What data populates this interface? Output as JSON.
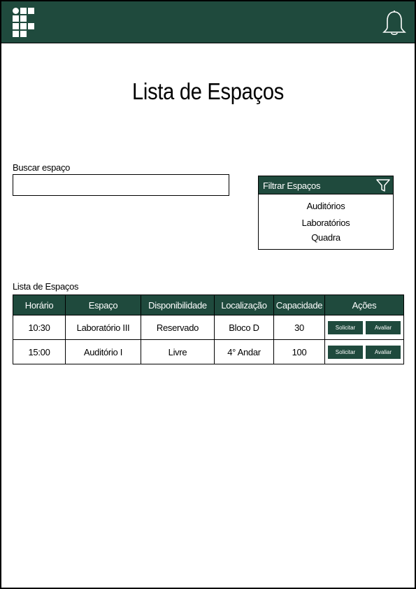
{
  "header": {
    "logo_icon": "institute-logo-icon",
    "notification_icon": "bell-icon",
    "brand_color": "#1f4a3d"
  },
  "page": {
    "title": "Lista de Espaços"
  },
  "search": {
    "label": "Buscar espaço",
    "value": "",
    "placeholder": ""
  },
  "filter": {
    "title": "Filtrar Espaços",
    "icon": "funnel-icon",
    "options": [
      "Auditórios",
      "Laboratórios",
      "Quadra"
    ]
  },
  "list": {
    "label": "Lista de Espaços",
    "columns": [
      "Horário",
      "Espaço",
      "Disponibilidade",
      "Localização",
      "Capacidade",
      "Ações"
    ],
    "rows": [
      {
        "horario": "10:30",
        "espaco": "Laboratório III",
        "disponibilidade": "Reservado",
        "localizacao": "Bloco D",
        "capacidade": "30",
        "action_request": "Solicitar",
        "action_rate": "Avaliar"
      },
      {
        "horario": "15:00",
        "espaco": "Auditório I",
        "disponibilidade": "Livre",
        "localizacao": "4° Andar",
        "capacidade": "100",
        "action_request": "Solicitar",
        "action_rate": "Avaliar"
      }
    ]
  }
}
